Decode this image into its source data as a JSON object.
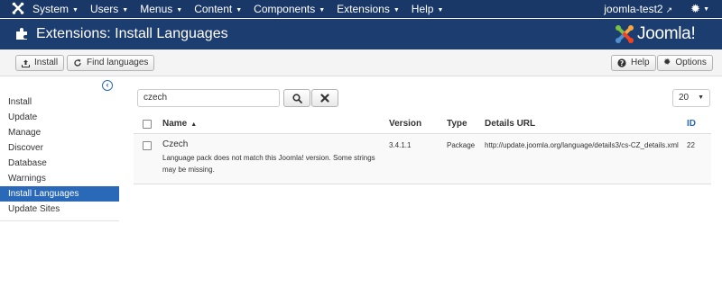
{
  "topbar": {
    "menus": [
      {
        "label": "System"
      },
      {
        "label": "Users"
      },
      {
        "label": "Menus"
      },
      {
        "label": "Content"
      },
      {
        "label": "Components"
      },
      {
        "label": "Extensions"
      },
      {
        "label": "Help"
      }
    ],
    "site_name": "joomla-test2"
  },
  "header": {
    "title": "Extensions: Install Languages",
    "brand": "Joomla!"
  },
  "toolbar": {
    "install_label": "Install",
    "find_languages_label": "Find languages",
    "help_label": "Help",
    "options_label": "Options"
  },
  "sidebar": {
    "items": [
      {
        "label": "Install"
      },
      {
        "label": "Update"
      },
      {
        "label": "Manage"
      },
      {
        "label": "Discover"
      },
      {
        "label": "Database"
      },
      {
        "label": "Warnings"
      },
      {
        "label": "Install Languages"
      },
      {
        "label": "Update Sites"
      }
    ],
    "active_index": 6
  },
  "filter": {
    "search_value": "czech",
    "list_limit": "20"
  },
  "table": {
    "columns": {
      "name": "Name",
      "version": "Version",
      "type": "Type",
      "details_url": "Details URL",
      "id": "ID"
    },
    "rows": [
      {
        "name": "Czech",
        "message": "Language pack does not match this Joomla! version. Some strings may be missing.",
        "version": "3.4.1.1",
        "type": "Package",
        "details_url": "http://update.joomla.org/language/details3/cs-CZ_details.xml",
        "id": "22"
      }
    ]
  },
  "colors": {
    "topbar": "#1a3867",
    "header": "#1c3d6f",
    "accent": "#2a69b8"
  }
}
